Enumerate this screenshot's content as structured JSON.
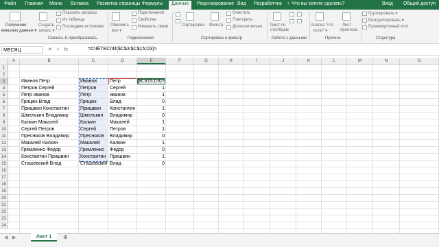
{
  "ribbon_tabs": [
    "Файл",
    "Главная",
    "Меню",
    "Вставка",
    "Разметка страницы",
    "Формулы",
    "Данные",
    "Рецензирование",
    "Вид",
    "Разработчик"
  ],
  "active_tab": "Данные",
  "tell_me": "♀ Что вы хотите сделать?",
  "login": "Вход",
  "share": "Общий доступ",
  "ribbon": {
    "get_data_1": "Получение",
    "get_data_2": "внешних данных ▾",
    "new_query_1": "Создать",
    "new_query_2": "запрос ▾",
    "show_queries": "Показать запросы",
    "from_table": "Из таблицы",
    "recent_sources": "Последние источники",
    "refresh_1": "Обновить",
    "refresh_2": "все ▾",
    "connections": "Подключения",
    "properties": "Свойства",
    "edit_links": "Изменить связи",
    "sort": "Сортировка",
    "filter": "Фильтр",
    "clear": "Очистить",
    "reapply": "Повторить",
    "advanced": "Дополнительно",
    "text_to_cols_1": "Текст по",
    "text_to_cols_2": "столбцам",
    "whatif_1": "Анализ \"что",
    "whatif_2": "если\" ▾",
    "forecast_1": "Лист",
    "forecast_2": "прогноза",
    "group": "Группировать ▾",
    "ungroup": "Разгруппировать ▾",
    "subtotal": "Промежуточный итог",
    "group_get": "Скачать & преобразовать",
    "group_conn": "Подключения",
    "group_sort": "Сортировка и фильтр",
    "group_tools": "Работа с данными",
    "group_forecast": "Прогноз",
    "group_outline": "Структура"
  },
  "name_box": "МЕСЯЦ",
  "fx_cancel": "✕",
  "fx_enter": "✓",
  "fx_label": "fx",
  "formula": "=СЧЁТЕСЛИ($C$3:$C$15;D3)>",
  "columns": [
    "A",
    "B",
    "C",
    "D",
    "E",
    "F",
    "G",
    "H",
    "I",
    "J",
    "K",
    "L",
    "M",
    "N",
    "O"
  ],
  "rows": [
    "1",
    "2",
    "3",
    "4",
    "5",
    "6",
    "7",
    "8",
    "9",
    "10",
    "11",
    "12",
    "13",
    "14",
    "15",
    "16",
    "17",
    "18",
    "19",
    "20",
    "21",
    "22",
    "23",
    "24"
  ],
  "colB": [
    "Иванов Петр",
    "Петров Сергей",
    "Петр иванов",
    "Грицюк Влад",
    "Пришвин Константин",
    "Шмелькин Владимир",
    "Калкин Макалей",
    "Сергей Петров",
    "Пресняков Владимир",
    "Макалей Калкин",
    "Гремленко Федор",
    "Константин Пришвин",
    "Сташевский Влад"
  ],
  "colC": [
    "Иванов",
    "Петров",
    "Петр",
    "Грицюк",
    "Пришвин",
    "Шмелькин",
    "Калкин",
    "Сергей",
    "Пресняков",
    "Макалей",
    "Гремленко",
    "Константин",
    "Сташевский"
  ],
  "colD": [
    "Петр",
    "Сергей",
    "иванов",
    "Влад",
    "Константин",
    "Владимир",
    "Макалей",
    "Петров",
    "Владимир",
    "Калкин",
    "Федор",
    "Пришвин",
    "Влад"
  ],
  "colE_edit": "$C$15;D3)>",
  "colE": [
    "",
    "1",
    "1",
    "0",
    "1",
    "0",
    "1",
    "1",
    "0",
    "1",
    "0",
    "1",
    "0"
  ],
  "sheet_name": "Лист 1",
  "add_sheet": "⊕"
}
